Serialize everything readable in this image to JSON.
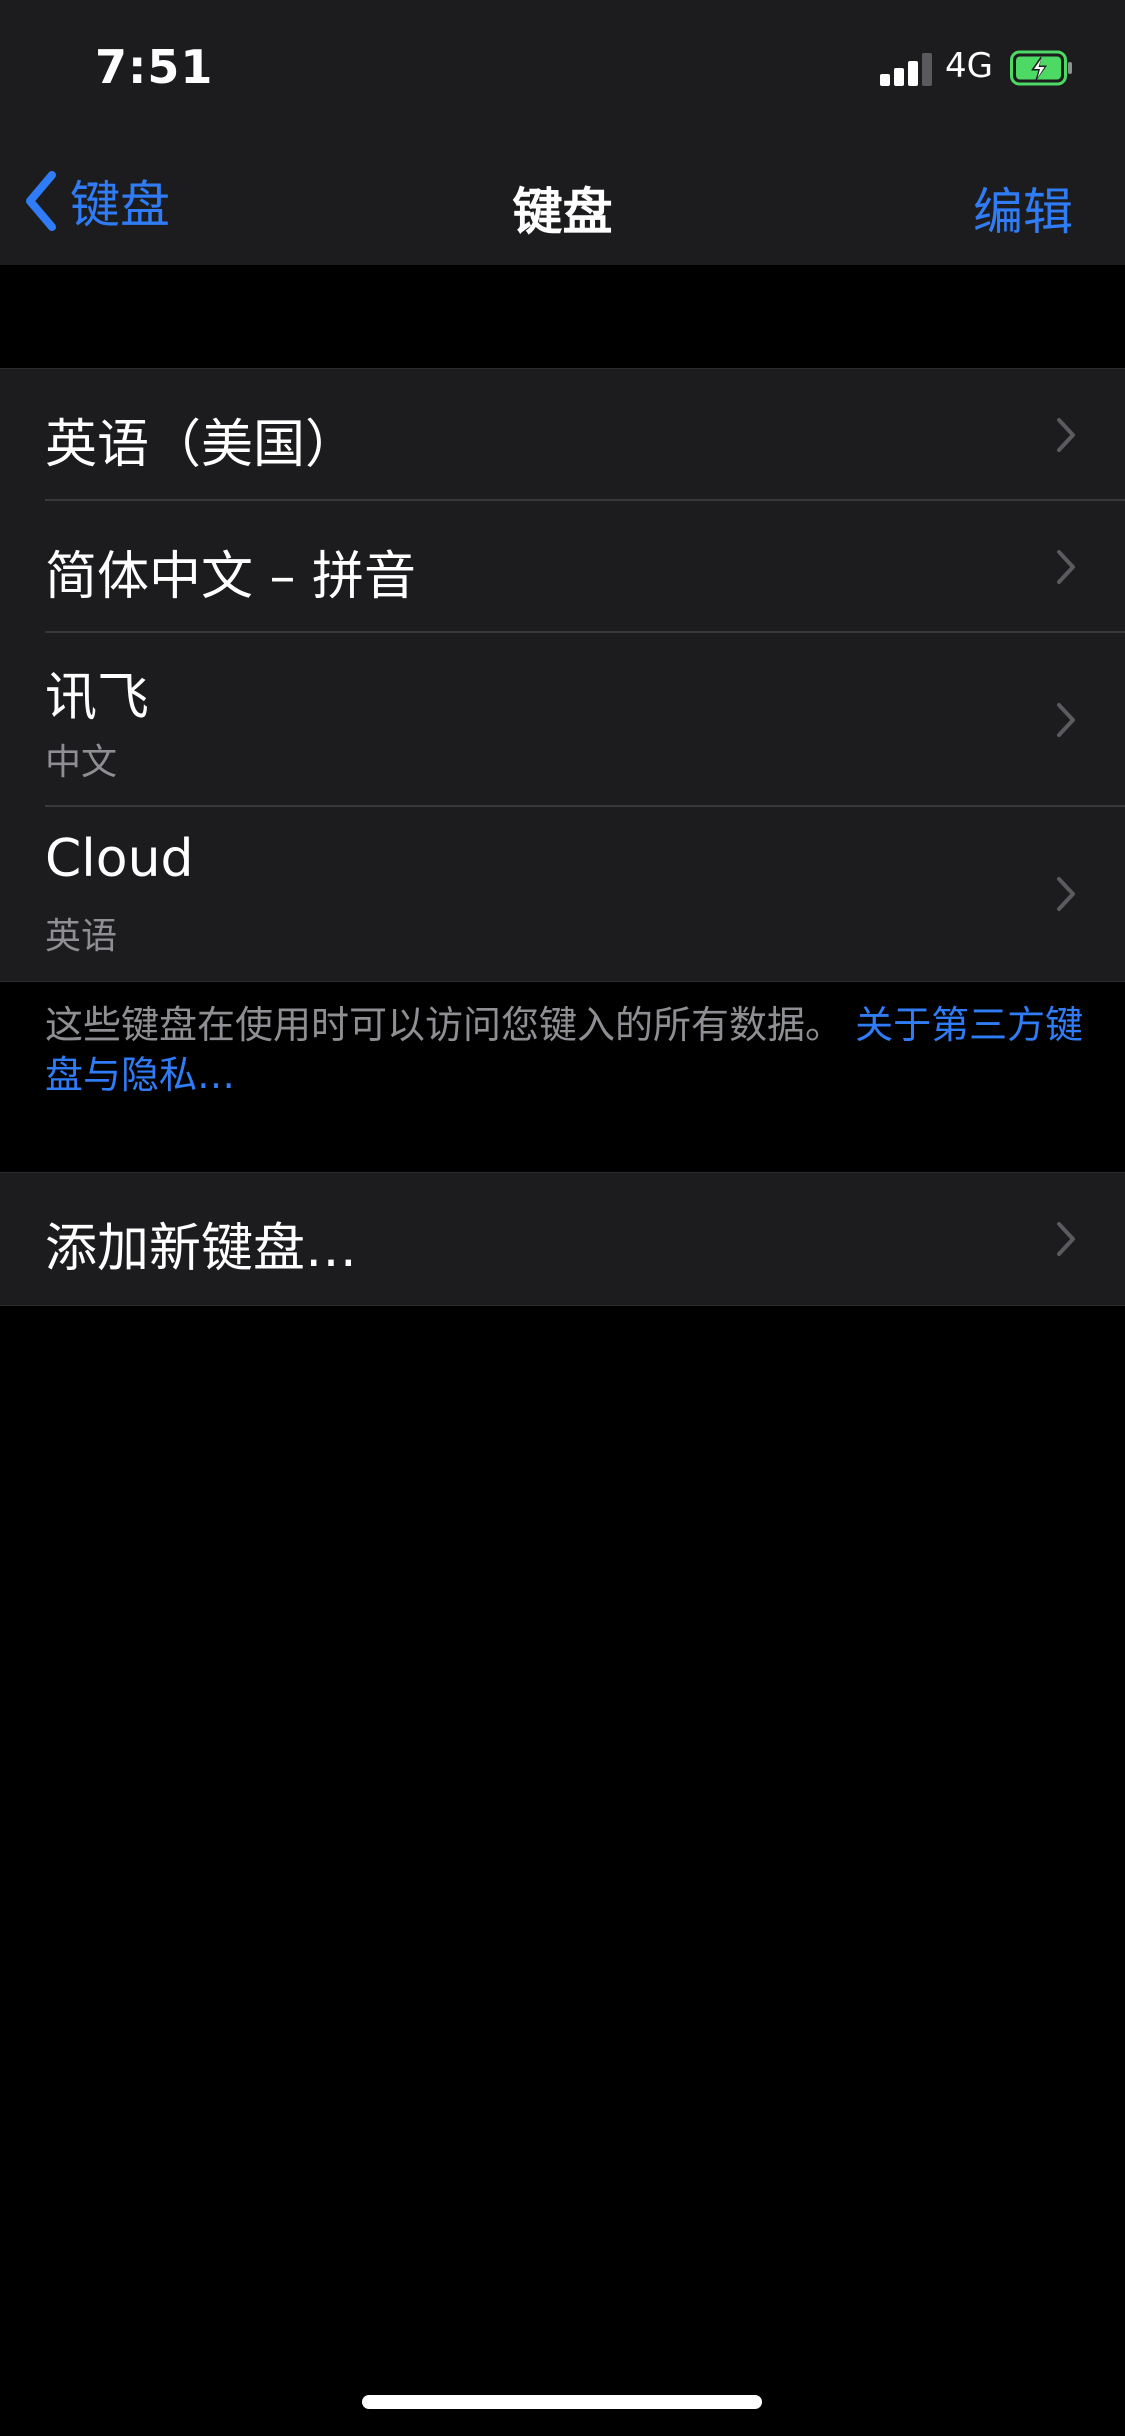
{
  "status_bar": {
    "time": "7:51",
    "network": "4G",
    "signal_bars": 3,
    "battery": "charging"
  },
  "nav": {
    "back_label": "键盘",
    "title": "键盘",
    "edit_label": "编辑"
  },
  "keyboards": [
    {
      "title": "英语（美国）",
      "subtitle": ""
    },
    {
      "title": "简体中文 – 拼音",
      "subtitle": ""
    },
    {
      "title": "讯飞",
      "subtitle": "中文"
    },
    {
      "title": "Cloud",
      "subtitle": "英语"
    }
  ],
  "footer": {
    "note": "这些键盘在使用时可以访问您键入的所有数据。",
    "link": "关于第三方键盘与隐私…"
  },
  "add_keyboard": {
    "label": "添加新键盘…"
  },
  "colors": {
    "accent": "#2f7cf6",
    "background": "#000000",
    "cell": "#1c1c1e",
    "secondary_text": "#8e8e93",
    "battery_fill": "#4cd964"
  },
  "icons": [
    "back-chevron-icon",
    "chevron-right-icon",
    "signal-icon",
    "battery-charging-icon"
  ]
}
